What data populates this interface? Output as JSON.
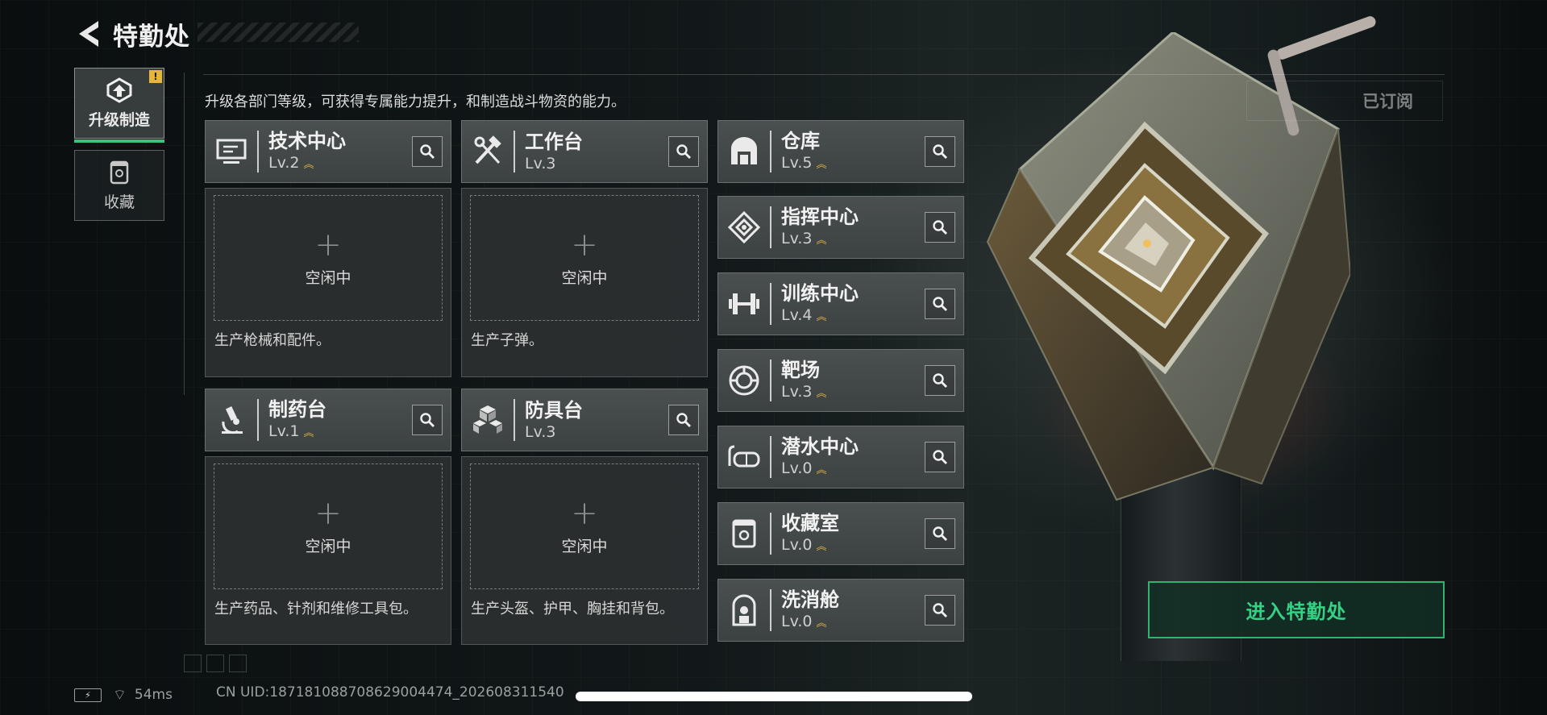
{
  "header": {
    "title": "特勤处",
    "back_icon": "chevron-left-icon"
  },
  "sidebar": {
    "tabs": [
      {
        "label": "升级制造",
        "icon": "upgrade-icon",
        "active": true,
        "badge": "!"
      },
      {
        "label": "收藏",
        "icon": "collection-icon",
        "active": false
      }
    ]
  },
  "description": "升级各部门等级，可获得专属能力提升，和制造战斗物资的能力。",
  "production_cards": [
    {
      "name": "技术中心",
      "level": "Lv.2",
      "upgradable": true,
      "icon": "monitor-icon",
      "slot_plus": "+",
      "slot_status": "空闲中",
      "desc": "生产枪械和配件。"
    },
    {
      "name": "工作台",
      "level": "Lv.3",
      "upgradable": false,
      "icon": "tools-icon",
      "slot_plus": "+",
      "slot_status": "空闲中",
      "desc": "生产子弹。"
    },
    {
      "name": "制药台",
      "level": "Lv.1",
      "upgradable": true,
      "icon": "microscope-icon",
      "slot_plus": "+",
      "slot_status": "空闲中",
      "desc": "生产药品、针剂和维修工具包。"
    },
    {
      "name": "防具台",
      "level": "Lv.3",
      "upgradable": false,
      "icon": "armor-cubes-icon",
      "slot_plus": "+",
      "slot_status": "空闲中",
      "desc": "生产头盔、护甲、胸挂和背包。"
    }
  ],
  "facilities": [
    {
      "name": "仓库",
      "level": "Lv.5",
      "upgradable": true,
      "icon": "warehouse-icon"
    },
    {
      "name": "指挥中心",
      "level": "Lv.3",
      "upgradable": true,
      "icon": "command-center-icon"
    },
    {
      "name": "训练中心",
      "level": "Lv.4",
      "upgradable": true,
      "icon": "dumbbell-icon"
    },
    {
      "name": "靶场",
      "level": "Lv.3",
      "upgradable": true,
      "icon": "target-icon"
    },
    {
      "name": "潜水中心",
      "level": "Lv.0",
      "upgradable": true,
      "icon": "diving-mask-icon"
    },
    {
      "name": "收藏室",
      "level": "Lv.0",
      "upgradable": true,
      "icon": "display-case-icon"
    },
    {
      "name": "洗消舱",
      "level": "Lv.0",
      "upgradable": true,
      "icon": "decon-pod-icon"
    }
  ],
  "subscribed_label": "已订阅",
  "enter_button": "进入特勤处",
  "status_bar": {
    "ping": "54ms",
    "uid": "CN UID:18718108870862900447​4_202608311540"
  },
  "colors": {
    "accent_green": "#32c77c",
    "upgrade_gold": "#e2b340",
    "panel": "#3c4142"
  }
}
